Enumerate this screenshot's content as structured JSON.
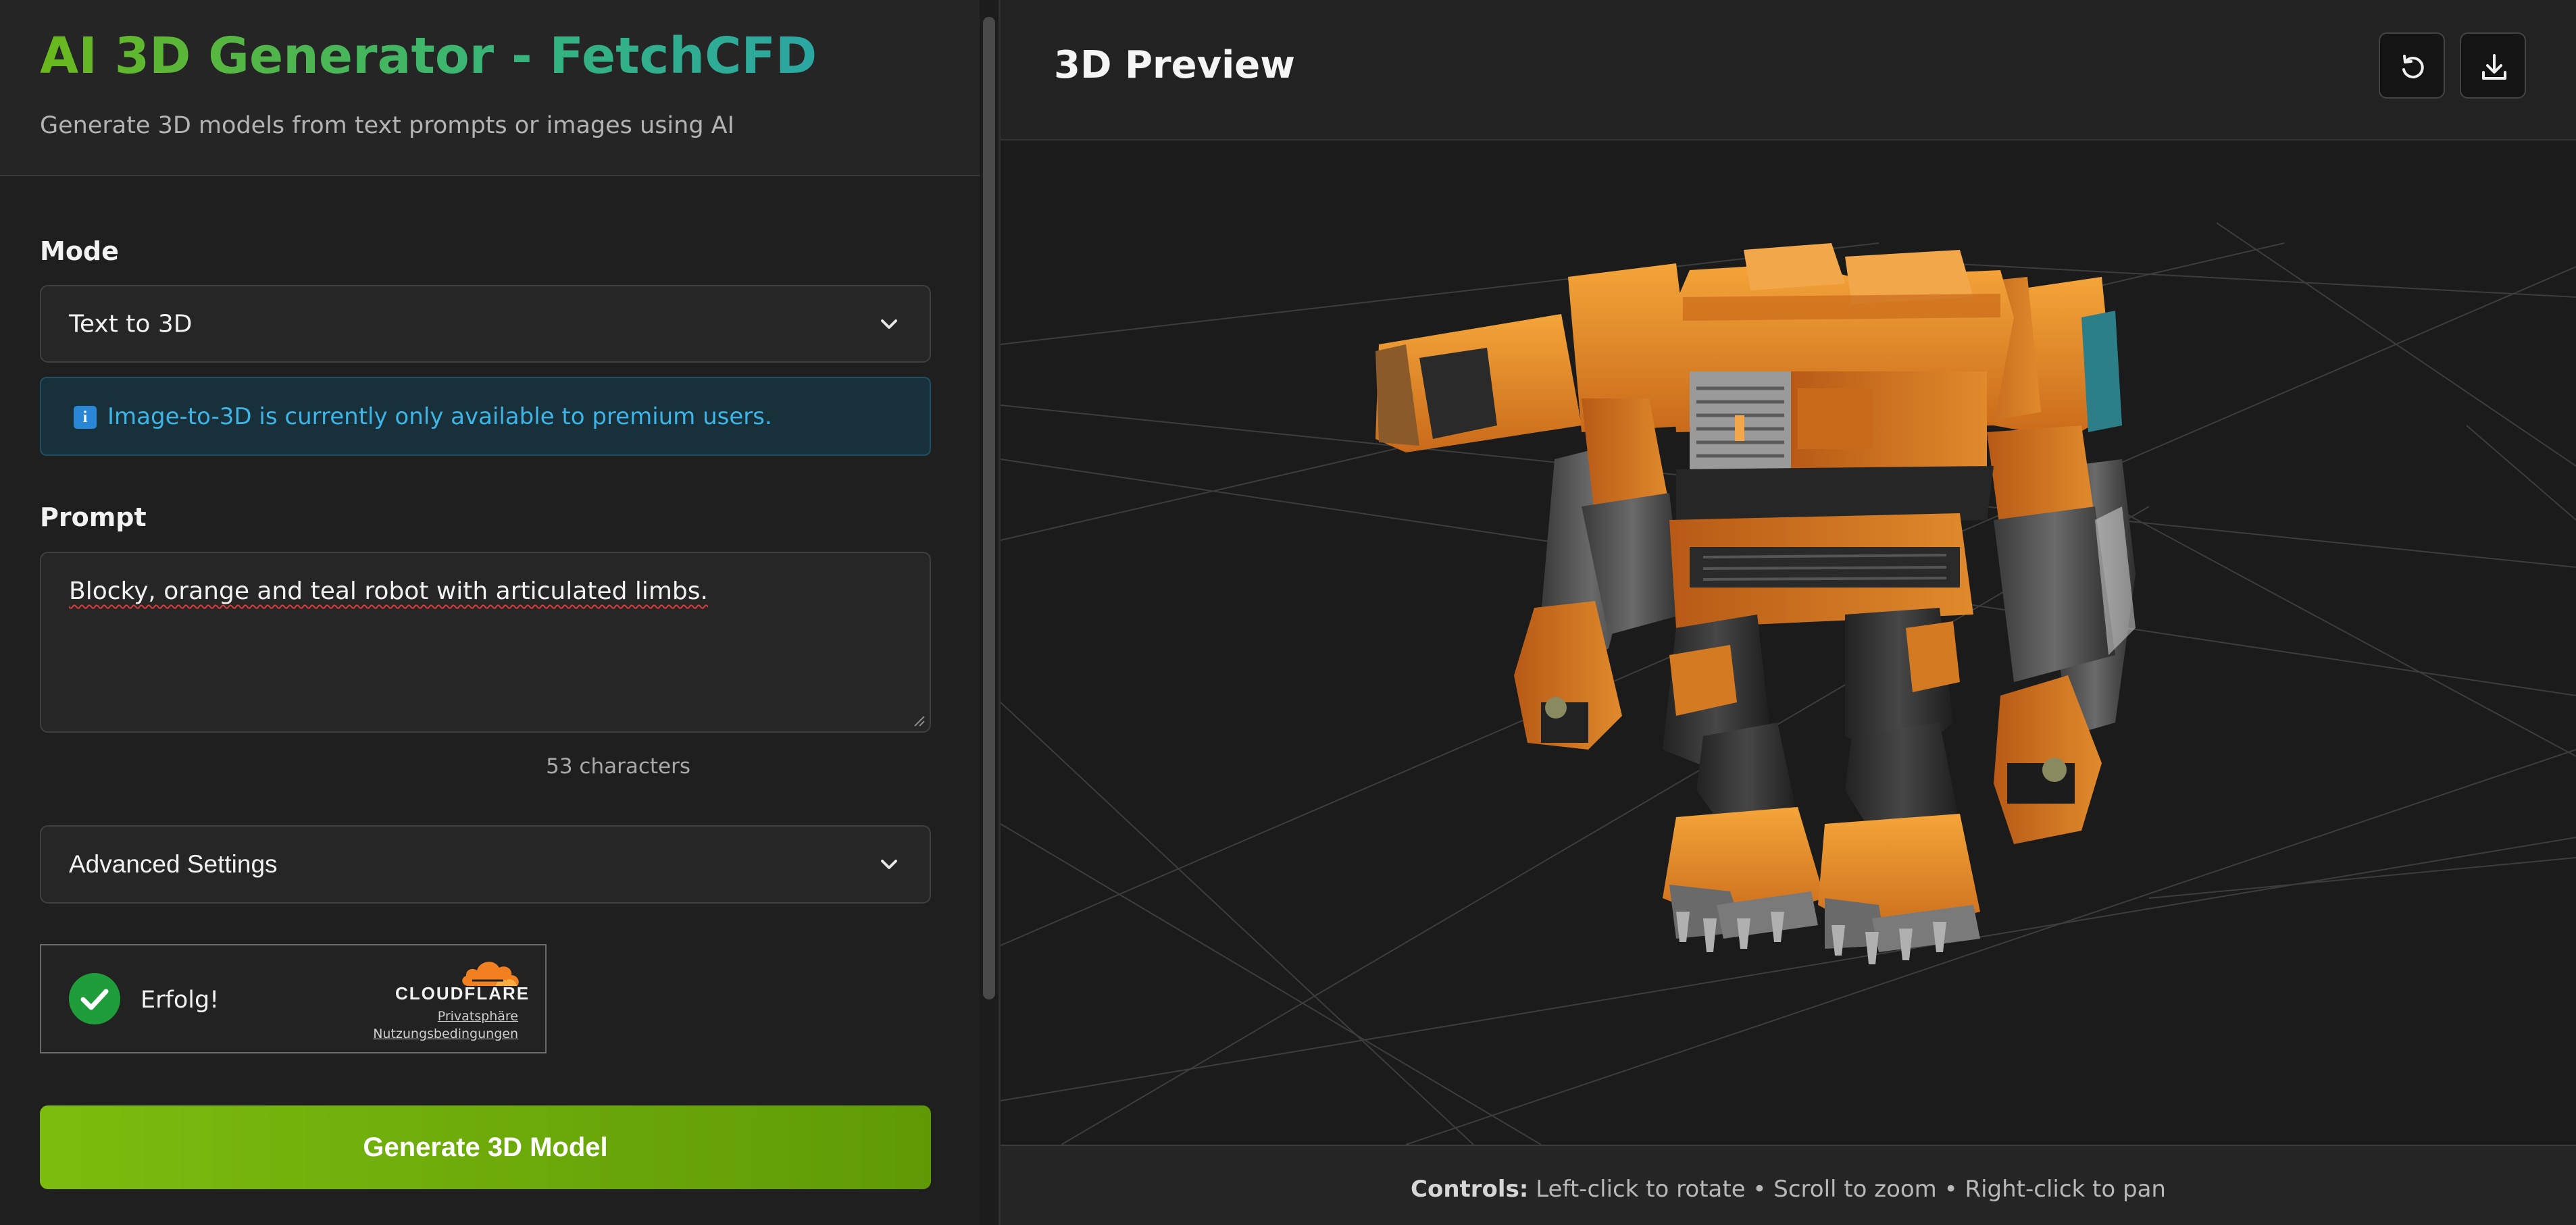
{
  "sidebar": {
    "title": "AI 3D Generator - FetchCFD",
    "subtitle": "Generate 3D models from text prompts or images using AI",
    "mode": {
      "label": "Mode",
      "selected": "Text to 3D"
    },
    "notice": {
      "icon": "info-icon",
      "text": "Image-to-3D is currently only available to premium users."
    },
    "prompt": {
      "label": "Prompt",
      "value": "Blocky, orange and teal robot with articulated limbs.",
      "char_count": "53 characters"
    },
    "advanced": {
      "label": "Advanced Settings"
    },
    "captcha": {
      "status": "Erfolg!",
      "brand": "CLOUDFLARE",
      "privacy_link": "Privatsphäre",
      "terms_link": "Nutzungsbedingungen"
    },
    "generate_button": "Generate 3D Model"
  },
  "preview": {
    "title": "3D Preview",
    "reset_button_icon": "reset-view-icon",
    "download_button_icon": "download-icon",
    "controls_label": "Controls:",
    "controls_text": " Left-click to rotate • Scroll to zoom • Right-click to pan"
  },
  "colors": {
    "title_gradient_start": "#6ab81c",
    "title_gradient_end": "#2ba7a3",
    "notice_text": "#3fb4e6",
    "generate_button": "#74b40c",
    "robot_orange": "#e8922a",
    "success_green": "#1f9d3a"
  }
}
